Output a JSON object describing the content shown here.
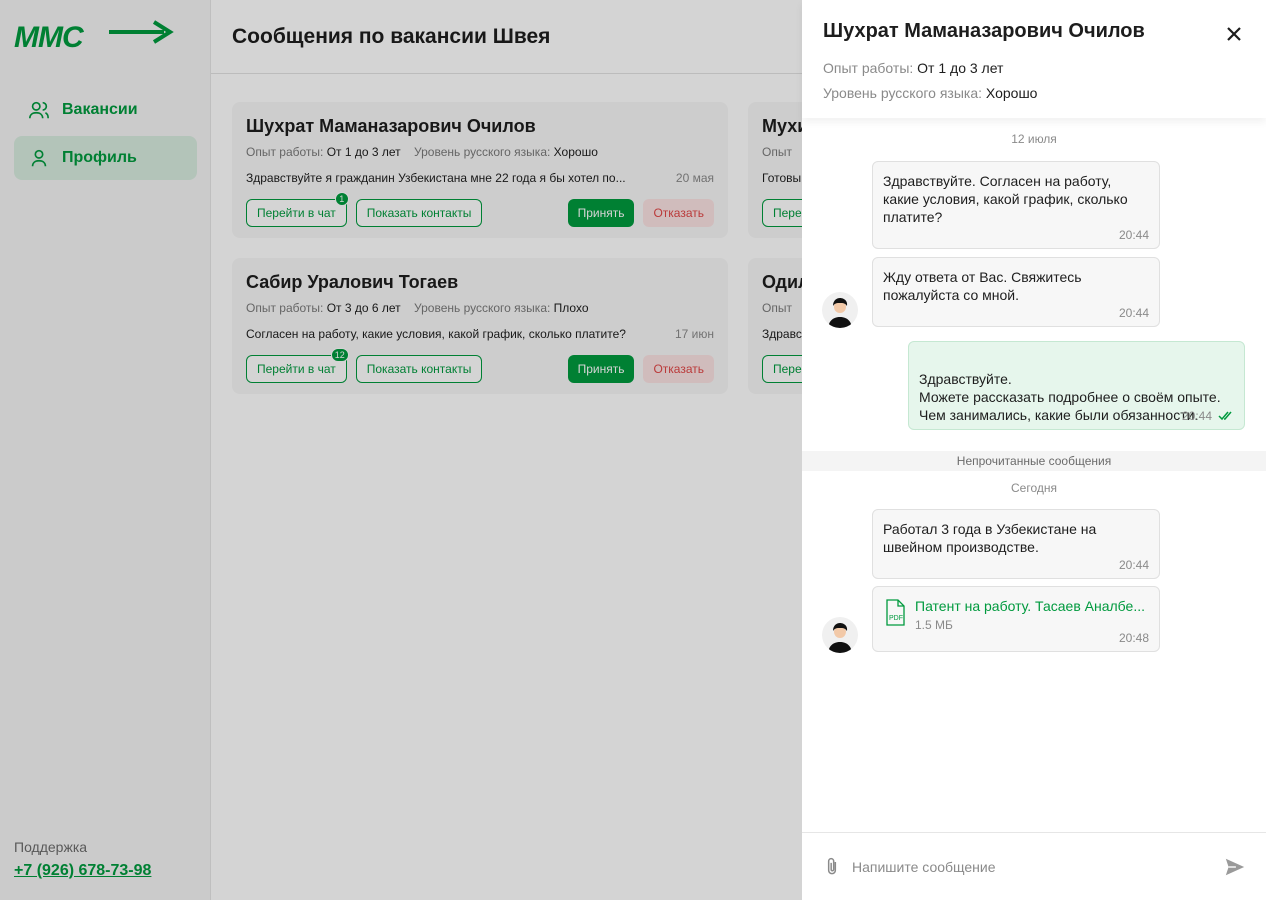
{
  "brand": {
    "logo_text": "MMC",
    "accent": "#009a3e",
    "danger": "#e04646"
  },
  "sidebar": {
    "items": [
      {
        "label": "Вакансии",
        "icon": "users-icon"
      },
      {
        "label": "Профиль",
        "icon": "user-icon"
      }
    ],
    "support_label": "Поддержка",
    "support_phone": "+7 (926) 678-73-98"
  },
  "page": {
    "title": "Сообщения по вакансии Швея"
  },
  "cards": [
    {
      "name": "Шухрат Маманазарович Очилов",
      "exp_label": "Опыт работы:",
      "exp": "От 1 до 3 лет",
      "lang_label": "Уровень русского языка:",
      "lang": "Хорошо",
      "message": "Здравствуйте я гражданин Узбекистана мне 22 года я бы хотел по...",
      "date": "20 мая",
      "chat_label": "Перейти в чат",
      "badge": "1",
      "contacts_label": "Показать контакты",
      "accept_label": "Принять",
      "reject_label": "Отказать"
    },
    {
      "name": "Мухи",
      "exp_label": "Опыт",
      "message": "Готовы",
      "chat_label": "Пере"
    },
    {
      "name": "Сабир Уралович Тогаев",
      "exp_label": "Опыт работы:",
      "exp": "От 3 до 6 лет",
      "lang_label": "Уровень русского языка:",
      "lang": "Плохо",
      "message": "Согласен на работу, какие условия, какой график, сколько платите?",
      "date": "17 июн",
      "chat_label": "Перейти в чат",
      "badge": "12",
      "contacts_label": "Показать контакты",
      "accept_label": "Принять",
      "reject_label": "Отказать"
    },
    {
      "name": "Одил",
      "exp_label": "Опыт",
      "message": "Здравс",
      "chat_label": "Пере"
    }
  ],
  "panel": {
    "title": "Шухрат Маманазарович Очилов",
    "exp_label": "Опыт работы:",
    "exp": "От 1 до 3 лет",
    "lang_label": "Уровень русского языка:",
    "lang": "Хорошо",
    "day1": "12 июля",
    "messages": [
      {
        "text": "Здравствуйте. Согласен на работу, какие условия, какой график, сколько платите?",
        "time": "20:44",
        "dir": "in"
      },
      {
        "text": "Жду ответа от Вас. Свяжитесь пожалуйста со мной.",
        "time": "20:44",
        "dir": "in"
      },
      {
        "text": "Здравствуйте.\nМожете рассказать подробнее о своём опыте. Чем занимались, какие были обязанности.",
        "time": "20:44",
        "dir": "out",
        "status": "read-checkmarks-icon"
      },
      {
        "text": "Работал 3 года в Узбекистане на швейном производстве.",
        "time": "20:44",
        "dir": "in"
      }
    ],
    "unread_label": "Непрочитанные сообщения",
    "day2": "Сегодня",
    "file": {
      "name": "Патент на работу. Тасаев Аналбе...",
      "size": "1.5 МБ",
      "time": "20:48",
      "icon": "pdf-icon"
    },
    "composer_placeholder": "Напишите сообщение"
  }
}
